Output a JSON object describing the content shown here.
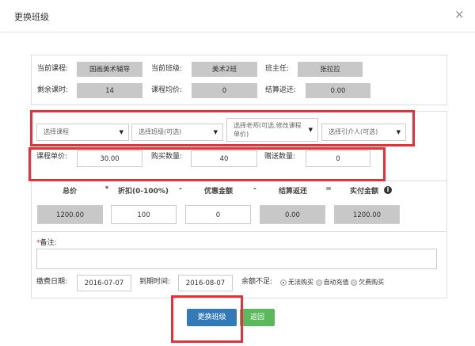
{
  "dialog": {
    "title": "更换班级",
    "close": "×"
  },
  "current": {
    "course_label": "当前课程:",
    "course": "国画美术辅导",
    "class_label": "当前班级:",
    "class": "美术2班",
    "teacher_label": "班主任:",
    "teacher": "张拉拉",
    "remaining_label": "剩余课时:",
    "remaining": "14",
    "avg_label": "课程均价:",
    "avg": "0",
    "refund_label": "结算返还:",
    "refund": "0.00"
  },
  "selects": {
    "course": "选择课程",
    "class": "选择班级(可选)",
    "teacher": "选择老师(可选,修改课程单价)",
    "referrer": "选择引介人(可选)"
  },
  "purchase": {
    "price_label": "课程单价:",
    "price": "30.00",
    "qty_label": "购买数量:",
    "qty": "40",
    "gift_label": "赠送数量:",
    "gift": "0"
  },
  "calc": {
    "headers": [
      "总价",
      "*",
      "折扣(0-100%)",
      "-",
      "优惠金额",
      "-",
      "结算返还",
      "=",
      "实付金额"
    ],
    "total": "1200.00",
    "discount": "100",
    "coupon": "0",
    "refund": "0.00",
    "paid": "1200.00"
  },
  "remark": {
    "required": "*",
    "label": "备注:",
    "value": ""
  },
  "dates": {
    "pay_label": "缴费日期:",
    "pay": "2016-07-07",
    "due_label": "到期时间:",
    "due": "2016-08-07"
  },
  "insufficient": {
    "label": "余额不足:",
    "options": [
      "无法购买",
      "自动充值",
      "欠费购买"
    ],
    "selected": 0
  },
  "buttons": {
    "submit": "更换班级",
    "back": "返回"
  },
  "colors": {
    "primary": "#337ab7",
    "success": "#5cb85c",
    "highlight": "#e8303a"
  }
}
